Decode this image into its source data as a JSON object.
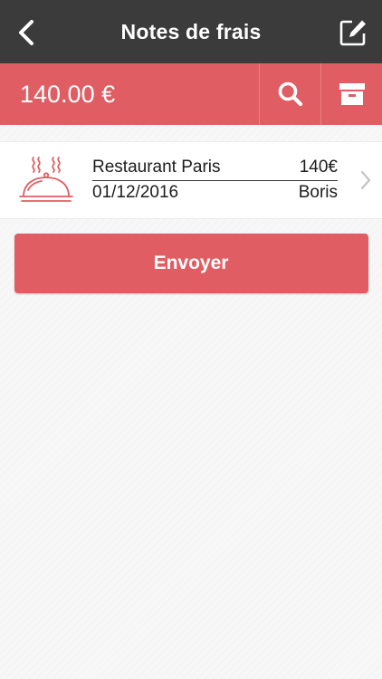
{
  "header": {
    "title": "Notes de frais",
    "back_icon": "chevron-left-icon",
    "edit_icon": "edit-icon"
  },
  "summary": {
    "total": "140.00 €",
    "search_icon": "search-icon",
    "archive_icon": "archive-icon"
  },
  "expenses": [
    {
      "icon": "food-cloche-icon",
      "name": "Restaurant Paris",
      "amount": "140€",
      "date": "01/12/2016",
      "person": "Boris"
    }
  ],
  "actions": {
    "send_label": "Envoyer"
  },
  "colors": {
    "header_bg": "#3b3b3b",
    "accent": "#e05e63",
    "background": "#f7f7f7"
  }
}
